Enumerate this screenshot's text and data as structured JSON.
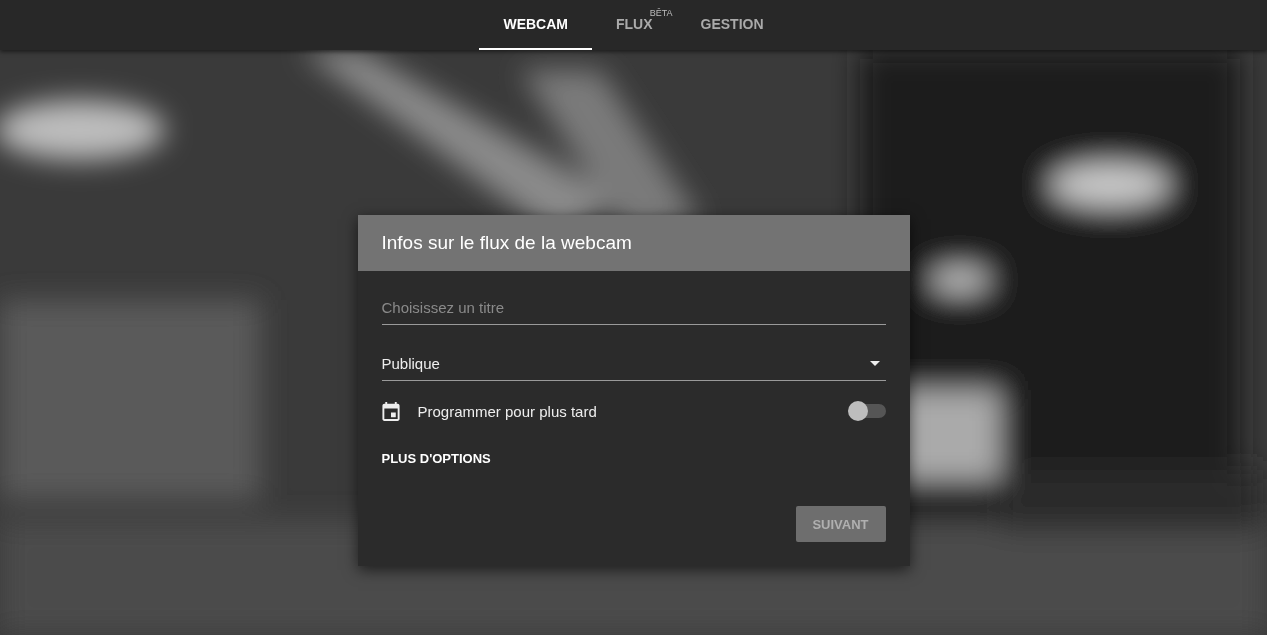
{
  "tabs": [
    {
      "label": "WEBCAM",
      "selected": true
    },
    {
      "label": "FLUX",
      "badge": "BÊTA",
      "selected": false
    },
    {
      "label": "GESTION",
      "selected": false
    }
  ],
  "dialog": {
    "title": "Infos sur le flux de la webcam",
    "title_field": {
      "placeholder": "Choisissez un titre"
    },
    "visibility_select": {
      "value": "Publique"
    },
    "schedule": {
      "label": "Programmer pour plus tard",
      "on": false
    },
    "more_options": "PLUS D'OPTIONS",
    "next_button": {
      "label": "SUIVANT",
      "disabled": true
    }
  }
}
